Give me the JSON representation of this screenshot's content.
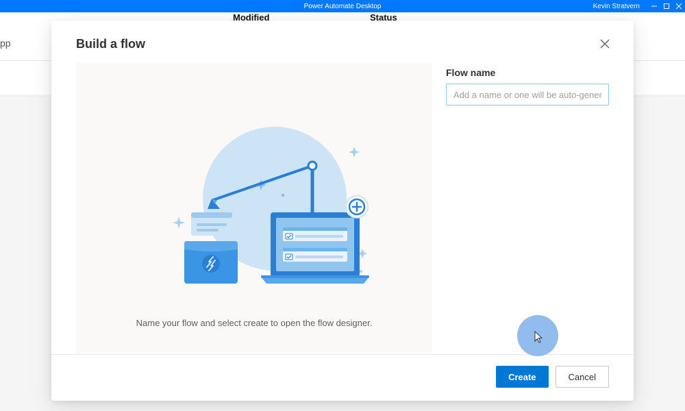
{
  "titlebar": {
    "app_title": "Power Automate Desktop",
    "user_name": "Kevin Stratvern"
  },
  "background": {
    "side_text": "pp",
    "col_modified": "Modified",
    "col_status": "Status"
  },
  "dialog": {
    "title": "Build a flow",
    "illustration_caption": "Name your flow and select create to open the flow designer.",
    "flow_name_label": "Flow name",
    "flow_name_placeholder": "Add a name or one will be auto-generated",
    "flow_name_value": "",
    "create_label": "Create",
    "cancel_label": "Cancel"
  }
}
